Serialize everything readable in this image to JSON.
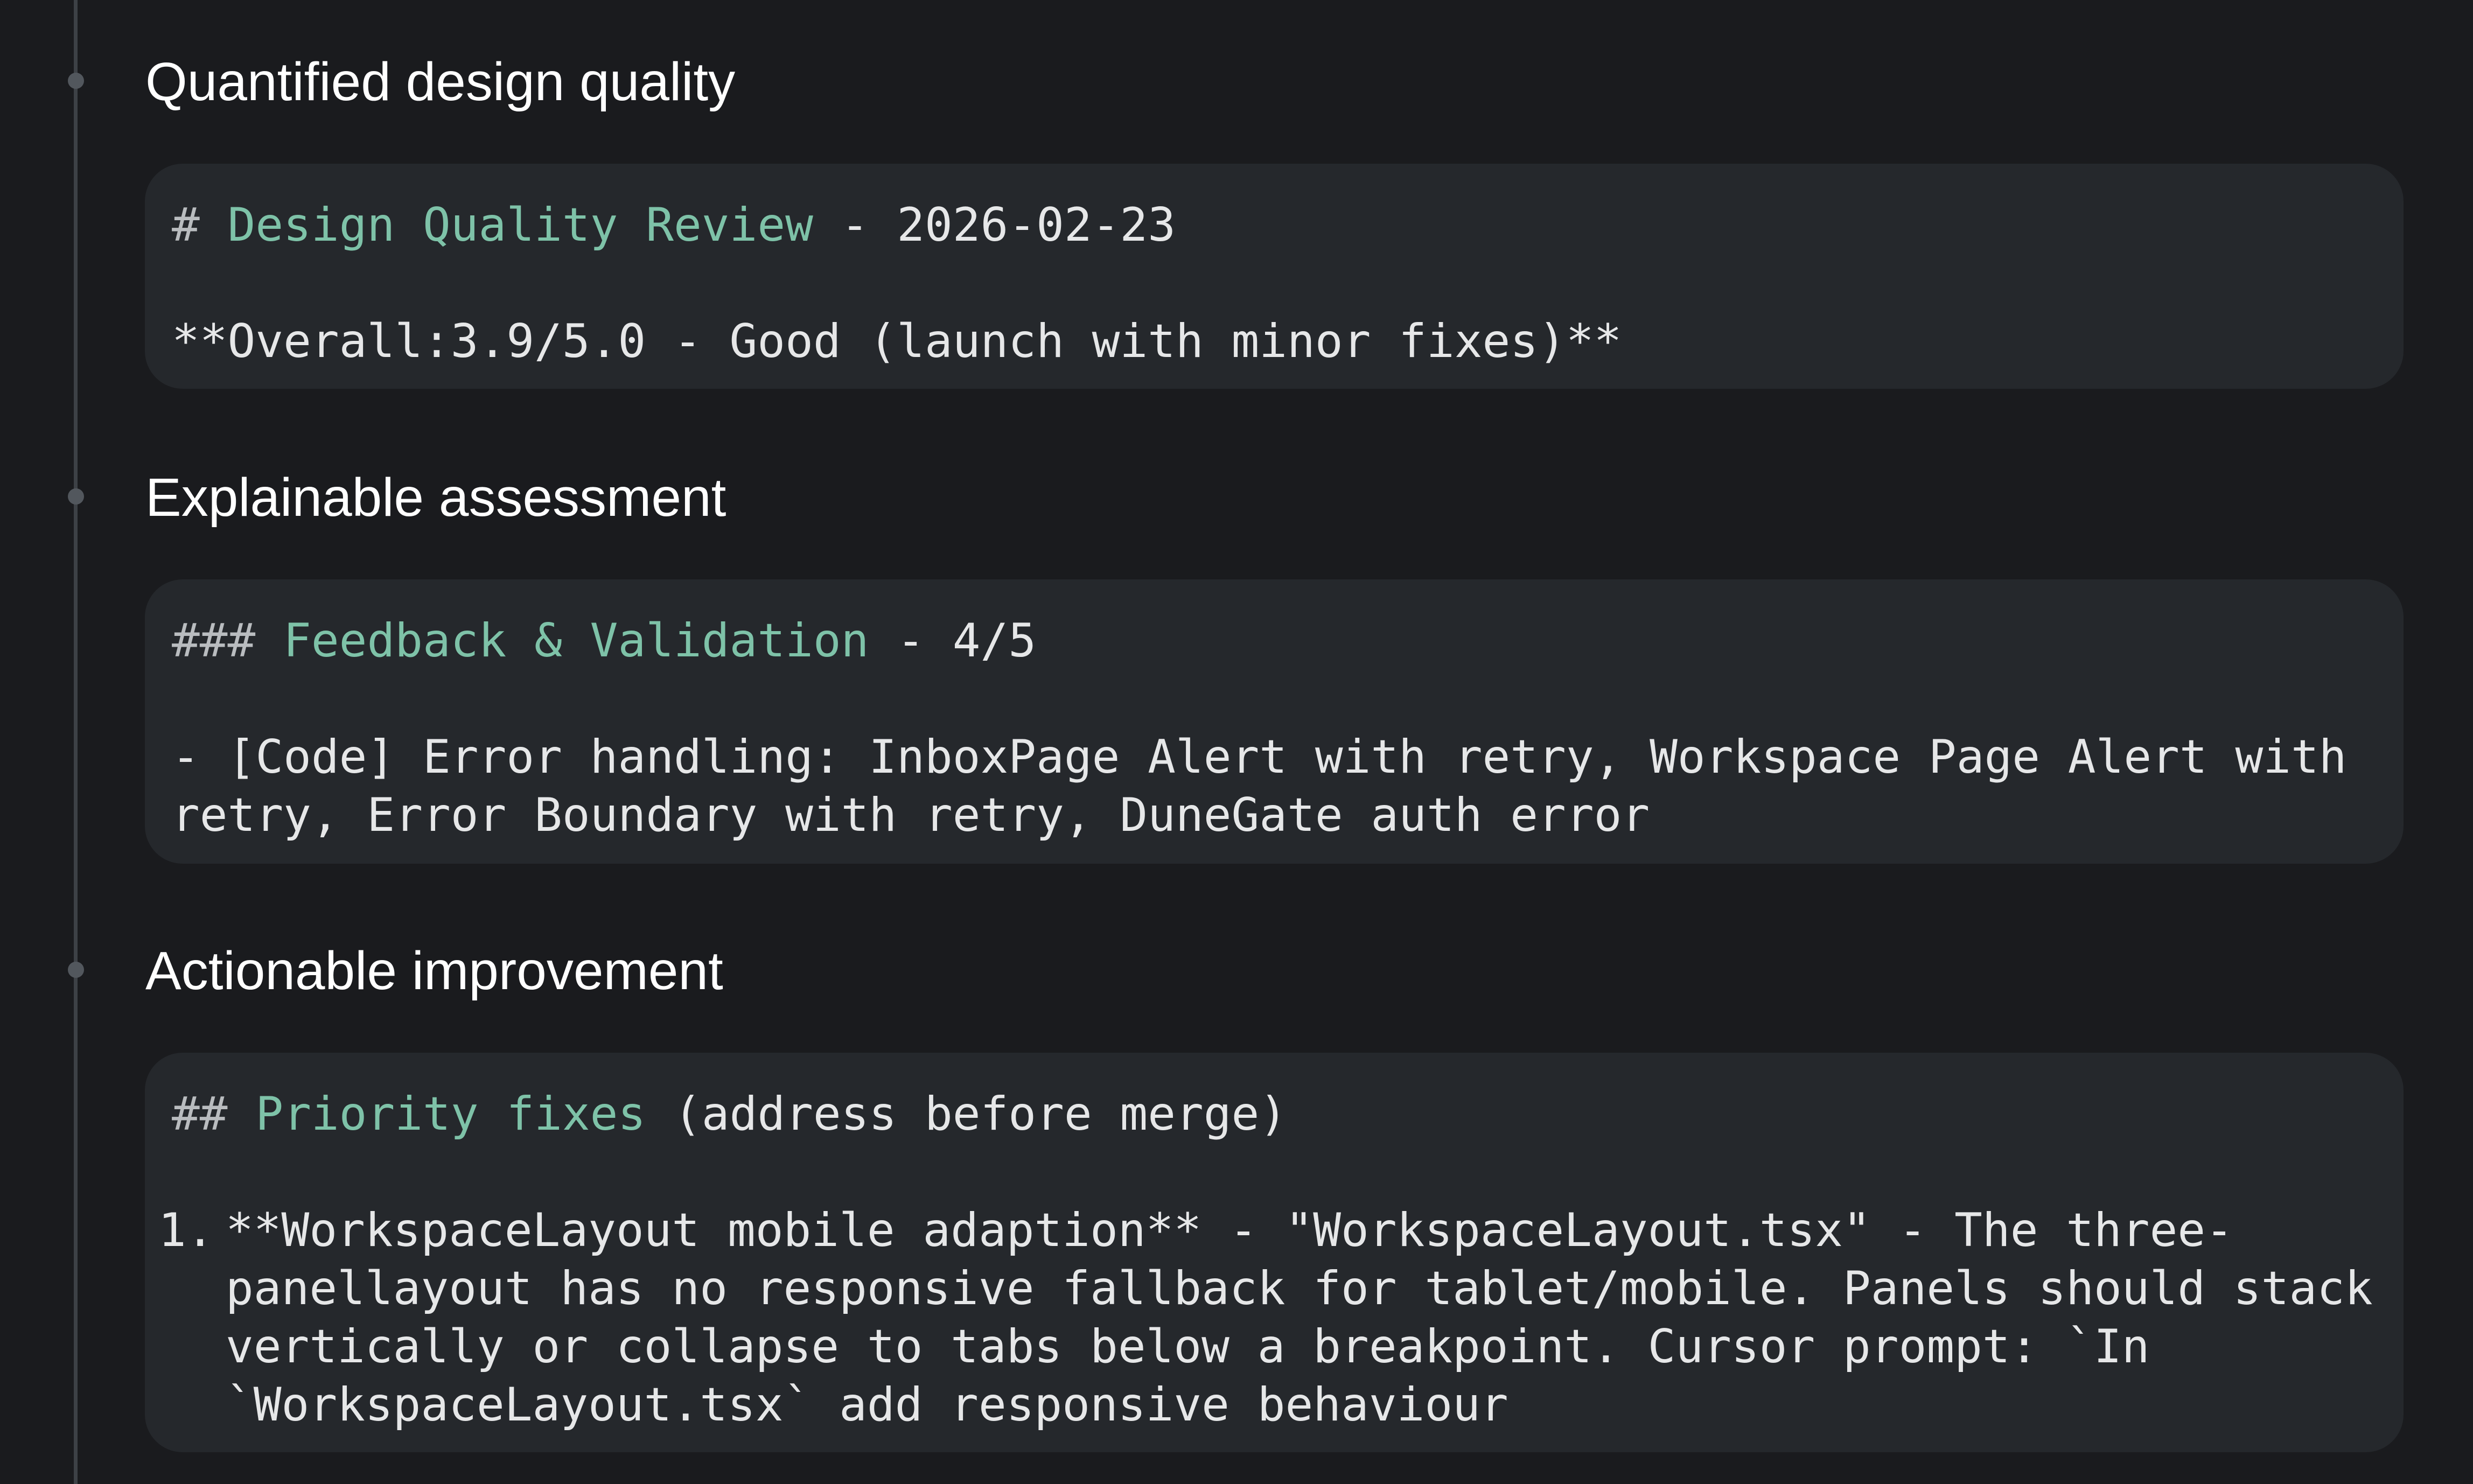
{
  "sections": [
    {
      "title": "Quantified design quality",
      "heading_marker": "#",
      "heading_text": "Design Quality Review",
      "heading_suffix": " - 2026-02-23",
      "body": "**Overall:3.9/5.0 - Good (launch with minor fixes)**"
    },
    {
      "title": "Explainable assessment",
      "heading_marker": "###",
      "heading_text": "Feedback & Validation",
      "heading_suffix": " - 4/5",
      "body_lines": [
        "- [Code] Error handling: InboxPage Alert with retry, Workspace Page Alert with",
        "retry, Error Boundary with retry, DuneGate auth error"
      ]
    },
    {
      "title": "Actionable improvement",
      "heading_marker": "##",
      "heading_text": "Priority fixes",
      "heading_suffix": " (address before merge)",
      "list_number": "1.",
      "list_lines": [
        "**WorkspaceLayout mobile adaption** - \"WorkspaceLayout.tsx\" - The three-",
        "panellayout has no responsive fallback for tablet/mobile. Panels should stack",
        "vertically or collapse to tabs below a breakpoint. Cursor prompt: `In",
        "`WorkspaceLayout.tsx` add responsive behaviour"
      ]
    }
  ]
}
